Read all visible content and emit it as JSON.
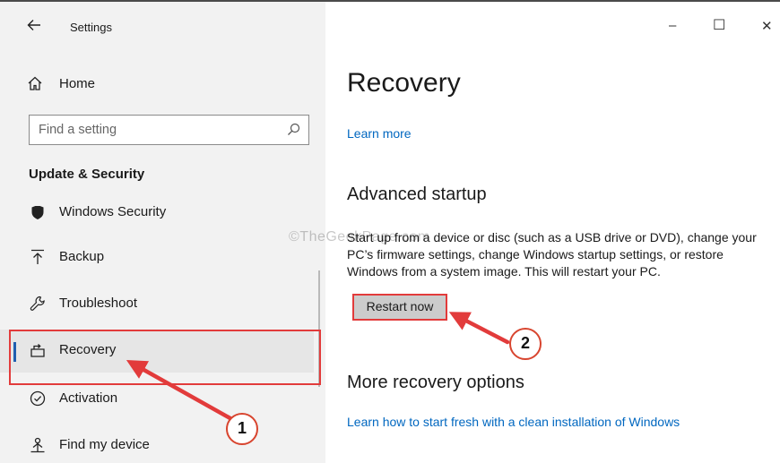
{
  "window": {
    "title": "Settings",
    "back_icon": "back-arrow-icon",
    "controls": {
      "minimize": "–",
      "maximize": "☐",
      "close": "✕"
    }
  },
  "sidebar": {
    "home": {
      "label": "Home",
      "icon": "home-icon"
    },
    "search": {
      "placeholder": "Find a setting",
      "icon": "search-icon"
    },
    "section": "Update & Security",
    "items": [
      {
        "label": "Windows Security",
        "icon": "shield-icon"
      },
      {
        "label": "Backup",
        "icon": "backup-icon"
      },
      {
        "label": "Troubleshoot",
        "icon": "wrench-icon"
      },
      {
        "label": "Recovery",
        "icon": "recovery-icon",
        "selected": true
      },
      {
        "label": "Activation",
        "icon": "checkmark-circle-icon"
      },
      {
        "label": "Find my device",
        "icon": "person-location-icon"
      }
    ]
  },
  "main": {
    "page_title": "Recovery",
    "learn_more": "Learn more",
    "advanced": {
      "heading": "Advanced startup",
      "description": "Start up from a device or disc (such as a USB drive or DVD), change your PC’s firmware settings, change Windows startup settings, or restore Windows from a system image. This will restart your PC.",
      "button": "Restart now"
    },
    "more": {
      "heading": "More recovery options",
      "link": "Learn how to start fresh with a clean installation of Windows"
    }
  },
  "annotations": {
    "watermark": "©TheGeekPage.com",
    "step1": "1",
    "step2": "2",
    "color": "#e23b3b"
  }
}
